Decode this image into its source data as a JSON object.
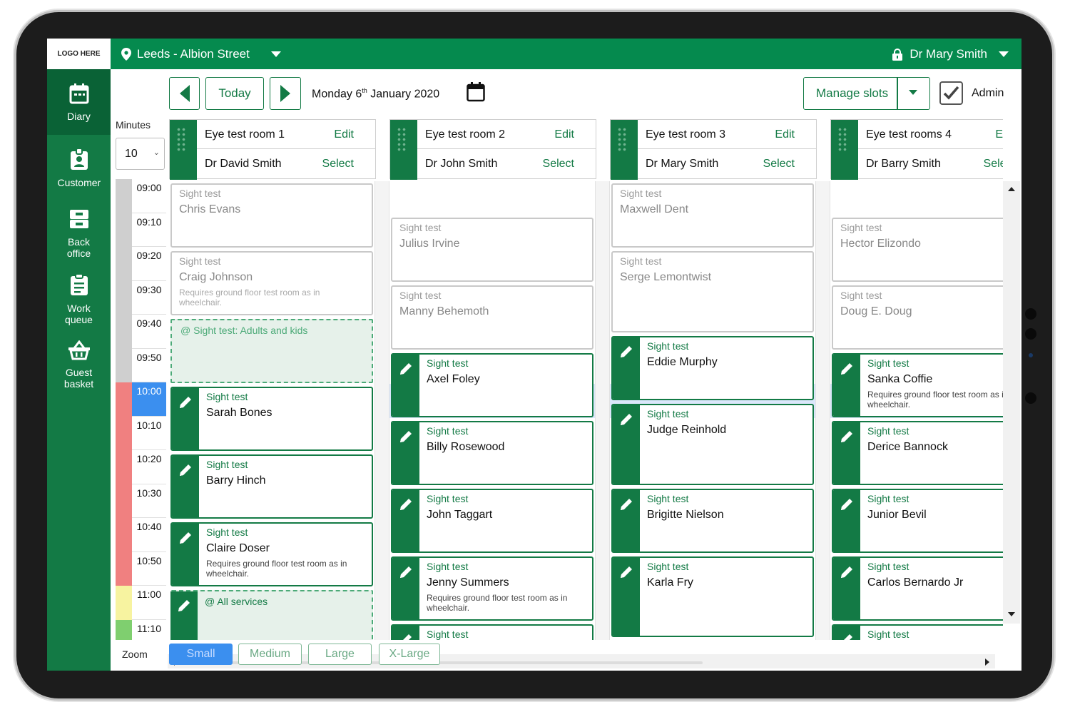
{
  "app": {
    "logo": "LOGO HERE",
    "location": "Leeds - Albion Street",
    "user": "Dr Mary Smith"
  },
  "sidebar": [
    {
      "label": "Diary",
      "icon": "calendar-icon"
    },
    {
      "label": "Customer",
      "icon": "id-badge-icon"
    },
    {
      "label": "Back office",
      "icon": "inbox-tray-icon"
    },
    {
      "label": "Work queue",
      "icon": "clipboard-icon"
    },
    {
      "label": "Guest basket",
      "icon": "basket-icon"
    }
  ],
  "toolbar": {
    "today": "Today",
    "date_main": "Monday 6",
    "date_sup": "th",
    "date_rest": " January 2020",
    "manage": "Manage slots",
    "admin": "Admin",
    "admin_checked": true
  },
  "minutes": {
    "label": "Minutes",
    "value": "10"
  },
  "times": [
    "09:00",
    "09:10",
    "09:20",
    "09:30",
    "09:40",
    "09:50",
    "10:00",
    "10:10",
    "10:20",
    "10:30",
    "10:40",
    "10:50",
    "11:00",
    "11:10"
  ],
  "current_time": "10:00",
  "edit_label": "Edit",
  "select_label": "Select",
  "rooms": [
    {
      "room": "Eye test room 1",
      "doctor": "Dr David Smith",
      "items": [
        {
          "kind": "ghost",
          "start": 0,
          "len": 2,
          "service": "Sight test",
          "name": "Chris Evans",
          "note": ""
        },
        {
          "kind": "ghost",
          "start": 2,
          "len": 2,
          "service": "Sight test",
          "name": "Craig Johnson",
          "note": "Requires ground floor test room as in wheelchair."
        },
        {
          "kind": "slot",
          "start": 4,
          "len": 2,
          "service": "@ Sight test: Adults and kids"
        },
        {
          "kind": "appt",
          "start": 6,
          "len": 2,
          "service": "Sight test",
          "name": "Sarah Bones",
          "note": ""
        },
        {
          "kind": "appt",
          "start": 8,
          "len": 2,
          "service": "Sight test",
          "name": "Barry Hinch",
          "note": ""
        },
        {
          "kind": "appt",
          "start": 10,
          "len": 2,
          "service": "Sight test",
          "name": "Claire Doser",
          "note": "Requires ground floor test room as in wheelchair."
        },
        {
          "kind": "slotbar",
          "start": 12,
          "len": 2,
          "service": "@ All services"
        }
      ]
    },
    {
      "room": "Eye test room 2",
      "doctor": "Dr John Smith",
      "items": [
        {
          "kind": "ghost",
          "start": 1,
          "len": 2,
          "service": "Sight test",
          "name": "Julius Irvine",
          "note": ""
        },
        {
          "kind": "ghost",
          "start": 3,
          "len": 2,
          "service": "Sight test",
          "name": "Manny Behemoth",
          "note": ""
        },
        {
          "kind": "appt",
          "start": 5,
          "len": 2,
          "service": "Sight test",
          "name": "Axel Foley",
          "note": ""
        },
        {
          "kind": "appt",
          "start": 7,
          "len": 2,
          "service": "Sight test",
          "name": "Billy Rosewood",
          "note": ""
        },
        {
          "kind": "appt",
          "start": 9,
          "len": 2,
          "service": "Sight test",
          "name": "John Taggart",
          "note": ""
        },
        {
          "kind": "appt",
          "start": 11,
          "len": 2,
          "service": "Sight test",
          "name": "Jenny Summers",
          "note": "Requires ground floor test room as in wheelchair."
        },
        {
          "kind": "appt",
          "start": 13,
          "len": 2,
          "service": "Sight test",
          "name": "",
          "note": ""
        }
      ]
    },
    {
      "room": "Eye test room 3",
      "doctor": "Dr Mary Smith",
      "items": [
        {
          "kind": "ghost",
          "start": 0,
          "len": 2,
          "service": "Sight test",
          "name": "Maxwell Dent",
          "note": ""
        },
        {
          "kind": "ghost",
          "start": 2,
          "len": 2.5,
          "service": "Sight test",
          "name": "Serge Lemontwist",
          "note": ""
        },
        {
          "kind": "appt",
          "start": 4.5,
          "len": 2,
          "service": "Sight test",
          "name": "Eddie Murphy",
          "note": ""
        },
        {
          "kind": "appt",
          "start": 6.5,
          "len": 2.5,
          "service": "Sight test",
          "name": "Judge Reinhold",
          "note": ""
        },
        {
          "kind": "appt",
          "start": 9,
          "len": 2,
          "service": "Sight test",
          "name": "Brigitte Nielson",
          "note": ""
        },
        {
          "kind": "appt",
          "start": 11,
          "len": 2.5,
          "service": "Sight test",
          "name": "Karla Fry",
          "note": ""
        }
      ]
    },
    {
      "room": "Eye test rooms 4",
      "doctor": "Dr Barry Smith",
      "items": [
        {
          "kind": "ghost",
          "start": 1,
          "len": 2,
          "service": "Sight test",
          "name": "Hector Elizondo",
          "note": ""
        },
        {
          "kind": "ghost",
          "start": 3,
          "len": 2,
          "service": "Sight test",
          "name": "Doug E. Doug",
          "note": ""
        },
        {
          "kind": "appt",
          "start": 5,
          "len": 2,
          "service": "Sight test",
          "name": "Sanka Coffie",
          "note": "Requires ground floor test room as in wheelchair."
        },
        {
          "kind": "appt",
          "start": 7,
          "len": 2,
          "service": "Sight test",
          "name": "Derice Bannock",
          "note": ""
        },
        {
          "kind": "appt",
          "start": 9,
          "len": 2,
          "service": "Sight test",
          "name": "Junior Bevil",
          "note": ""
        },
        {
          "kind": "appt",
          "start": 11,
          "len": 2,
          "service": "Sight test",
          "name": "Carlos Bernardo Jr",
          "note": ""
        },
        {
          "kind": "appt",
          "start": 13,
          "len": 2,
          "service": "Sight test",
          "name": "",
          "note": ""
        }
      ]
    }
  ],
  "zoom": {
    "label": "Zoom",
    "options": [
      "Small",
      "Medium",
      "Large",
      "X-Large"
    ],
    "selected": "Small"
  },
  "colors": {
    "brand": "#058a4e",
    "dark": "#137a45",
    "now": "#3b8fef",
    "band_past": "#cfcfcf",
    "band_red": "#f08080",
    "band_yellow": "#f7f3a0",
    "band_green": "#7fcf6f"
  }
}
